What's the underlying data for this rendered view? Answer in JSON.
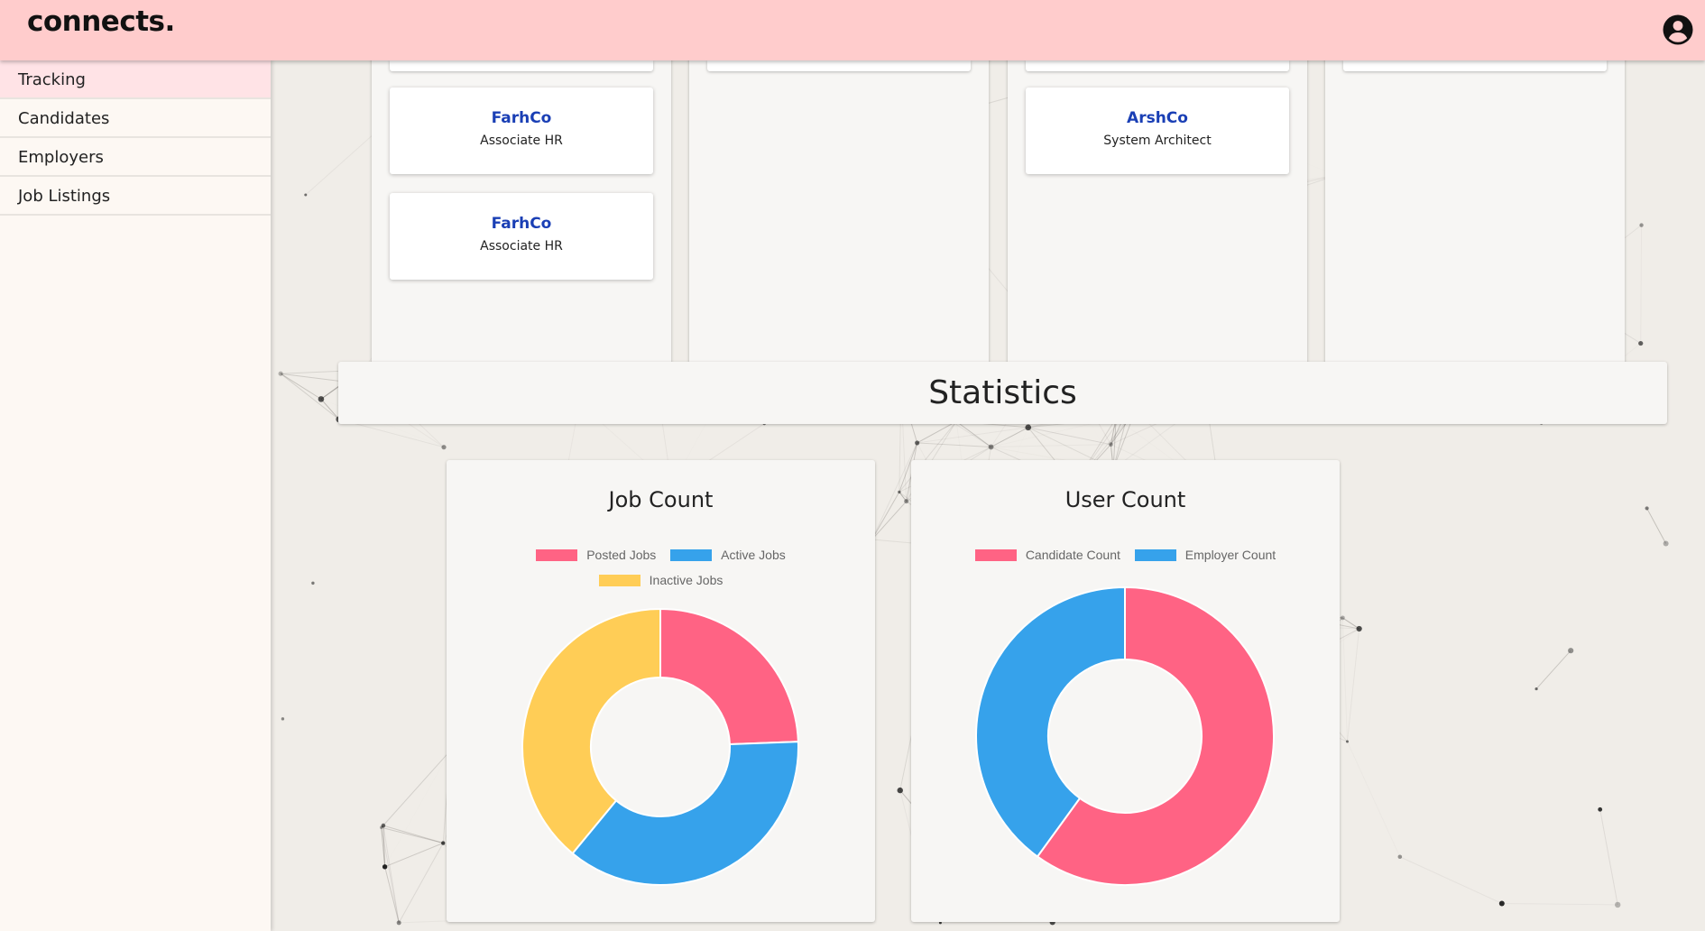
{
  "header": {
    "brand": "connects.",
    "account_icon": "account-circle-icon"
  },
  "sidebar": {
    "items": [
      {
        "label": "Tracking",
        "active": true
      },
      {
        "label": "Candidates",
        "active": false
      },
      {
        "label": "Employers",
        "active": false
      },
      {
        "label": "Job Listings",
        "active": false
      }
    ]
  },
  "board": {
    "cards": [
      {
        "company": "FarhCo",
        "role": "Associate HR"
      },
      {
        "company": "FarhCo",
        "role": "Associate HR"
      },
      {
        "company": "ArshCo",
        "role": "System Architect"
      }
    ]
  },
  "statistics": {
    "heading": "Statistics"
  },
  "colors": {
    "pink": "#ff6384",
    "blue": "#36a2eb",
    "yellow": "#ffcd56",
    "header": "#ffcccc",
    "company": "#1a3fb5"
  },
  "chart_data": [
    {
      "type": "pie",
      "title": "Job Count",
      "categories": [
        "Posted Jobs",
        "Active Jobs",
        "Inactive Jobs"
      ],
      "values": [
        2,
        3,
        3.2
      ],
      "colors": [
        "#ff6384",
        "#36a2eb",
        "#ffcd56"
      ],
      "legend": "top"
    },
    {
      "type": "pie",
      "title": "User Count",
      "categories": [
        "Candidate Count",
        "Employer Count"
      ],
      "values": [
        6,
        4
      ],
      "colors": [
        "#ff6384",
        "#36a2eb"
      ],
      "legend": "top"
    }
  ]
}
